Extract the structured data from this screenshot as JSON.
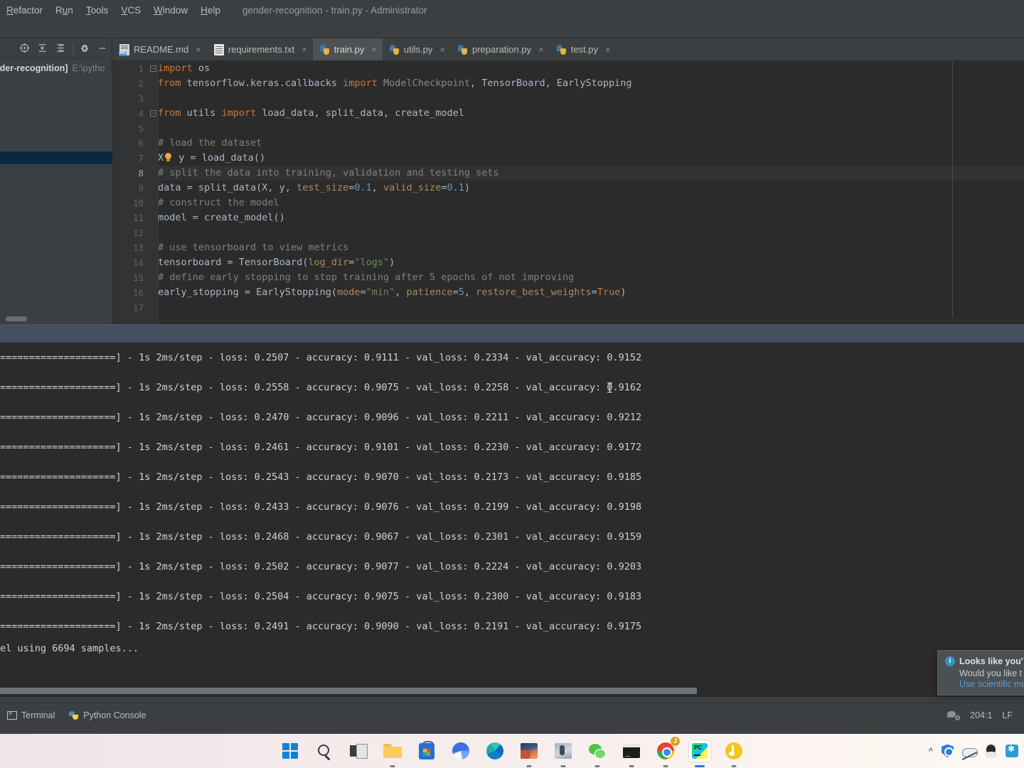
{
  "window": {
    "title": "gender-recognition - train.py - Administrator",
    "menu": [
      "Refactor",
      "Run",
      "Tools",
      "VCS",
      "Window",
      "Help"
    ]
  },
  "navstrip": {
    "crumb": "/"
  },
  "left_panel": {
    "toolbar_icons": [
      "locate-icon",
      "collapse-all-icon",
      "expand-all-icon",
      "settings-icon",
      "minimize-icon"
    ],
    "project_name": "nder-recognition]",
    "project_path": "E:\\pytho"
  },
  "tabs": [
    {
      "label": "README.md",
      "icon": "markdown-file-icon",
      "active": false,
      "close": "×"
    },
    {
      "label": "requirements.txt",
      "icon": "text-file-icon",
      "active": false,
      "close": "×"
    },
    {
      "label": "train.py",
      "icon": "python-file-icon",
      "active": true,
      "close": "×"
    },
    {
      "label": "utils.py",
      "icon": "python-file-icon",
      "active": false,
      "close": "×"
    },
    {
      "label": "preparation.py",
      "icon": "python-file-icon",
      "active": false,
      "close": "×"
    },
    {
      "label": "test.py",
      "icon": "python-file-icon",
      "active": false,
      "close": "×"
    }
  ],
  "editor": {
    "line_numbers": [
      "1",
      "2",
      "3",
      "4",
      "5",
      "6",
      "7",
      "8",
      "9",
      "10",
      "11",
      "12",
      "13",
      "14",
      "15",
      "16",
      "17"
    ],
    "current_line": 8,
    "lines": [
      {
        "n": 1,
        "text": "import os"
      },
      {
        "n": 2,
        "text": "from tensorflow.keras.callbacks import ModelCheckpoint, TensorBoard, EarlyStopping"
      },
      {
        "n": 3,
        "text": ""
      },
      {
        "n": 4,
        "text": "from utils import load_data, split_data, create_model"
      },
      {
        "n": 5,
        "text": ""
      },
      {
        "n": 6,
        "text": "# load the dataset"
      },
      {
        "n": 7,
        "text": "X, y = load_data()"
      },
      {
        "n": 8,
        "text": "# split the data into training, validation and testing sets"
      },
      {
        "n": 9,
        "text": "data = split_data(X, y, test_size=0.1, valid_size=0.1)"
      },
      {
        "n": 10,
        "text": "# construct the model"
      },
      {
        "n": 11,
        "text": "model = create_model()"
      },
      {
        "n": 12,
        "text": ""
      },
      {
        "n": 13,
        "text": "# use tensorboard to view metrics"
      },
      {
        "n": 14,
        "text": "tensorboard = TensorBoard(log_dir=\"logs\")"
      },
      {
        "n": 15,
        "text": "# define early stopping to stop training after 5 epochs of not improving"
      },
      {
        "n": 16,
        "text": "early_stopping = EarlyStopping(mode=\"min\", patience=5, restore_best_weights=True)"
      },
      {
        "n": 17,
        "text": ""
      }
    ],
    "intention_bulb": "lightbulb-icon"
  },
  "terminal": {
    "lines": [
      "====================] - 1s 2ms/step - loss: 0.2507 - accuracy: 0.9111 - val_loss: 0.2334 - val_accuracy: 0.9152",
      "====================] - 1s 2ms/step - loss: 0.2558 - accuracy: 0.9075 - val_loss: 0.2258 - val_accuracy: 0.9162",
      "====================] - 1s 2ms/step - loss: 0.2470 - accuracy: 0.9096 - val_loss: 0.2211 - val_accuracy: 0.9212",
      "====================] - 1s 2ms/step - loss: 0.2461 - accuracy: 0.9101 - val_loss: 0.2230 - val_accuracy: 0.9172",
      "====================] - 1s 2ms/step - loss: 0.2543 - accuracy: 0.9070 - val_loss: 0.2173 - val_accuracy: 0.9185",
      "====================] - 1s 2ms/step - loss: 0.2433 - accuracy: 0.9076 - val_loss: 0.2199 - val_accuracy: 0.9198",
      "====================] - 1s 2ms/step - loss: 0.2468 - accuracy: 0.9067 - val_loss: 0.2301 - val_accuracy: 0.9159",
      "====================] - 1s 2ms/step - loss: 0.2502 - accuracy: 0.9077 - val_loss: 0.2224 - val_accuracy: 0.9203",
      "====================] - 1s 2ms/step - loss: 0.2504 - accuracy: 0.9075 - val_loss: 0.2300 - val_accuracy: 0.9183",
      "====================] - 1s 2ms/step - loss: 0.2491 - accuracy: 0.9090 - val_loss: 0.2191 - val_accuracy: 0.9175"
    ],
    "final_line": "el using 6694 samples..."
  },
  "notification": {
    "icon": "info-icon",
    "title": "Looks like you'",
    "body": "Would you like t",
    "link": "Use scientific mo"
  },
  "statusbar": {
    "terminal_label": "Terminal",
    "python_console_label": "Python Console",
    "caret_position": "204:1",
    "line_separator": "LF",
    "inspections_icon": "inspections-icon"
  },
  "taskbar": {
    "icons": [
      {
        "name": "windows-start-icon",
        "running": false
      },
      {
        "name": "search-icon",
        "running": false
      },
      {
        "name": "task-view-icon",
        "running": false
      },
      {
        "name": "file-explorer-icon",
        "running": true
      },
      {
        "name": "microsoft-store-icon",
        "running": false
      },
      {
        "name": "swirl-app-icon",
        "running": false
      },
      {
        "name": "microsoft-edge-icon",
        "running": false
      },
      {
        "name": "photos-app-icon",
        "running": true
      },
      {
        "name": "gallery-app-icon",
        "running": true
      },
      {
        "name": "wechat-icon",
        "running": true
      },
      {
        "name": "command-prompt-icon",
        "running": true
      },
      {
        "name": "google-chrome-icon",
        "running": true,
        "badge": "J"
      },
      {
        "name": "pycharm-icon",
        "running": true,
        "active": true
      },
      {
        "name": "music-app-icon",
        "running": true
      }
    ],
    "tray": [
      "chevron-up-icon",
      "security-shield-icon",
      "cloud-off-icon",
      "qq-penguin-icon",
      "blue-message-icon"
    ]
  }
}
